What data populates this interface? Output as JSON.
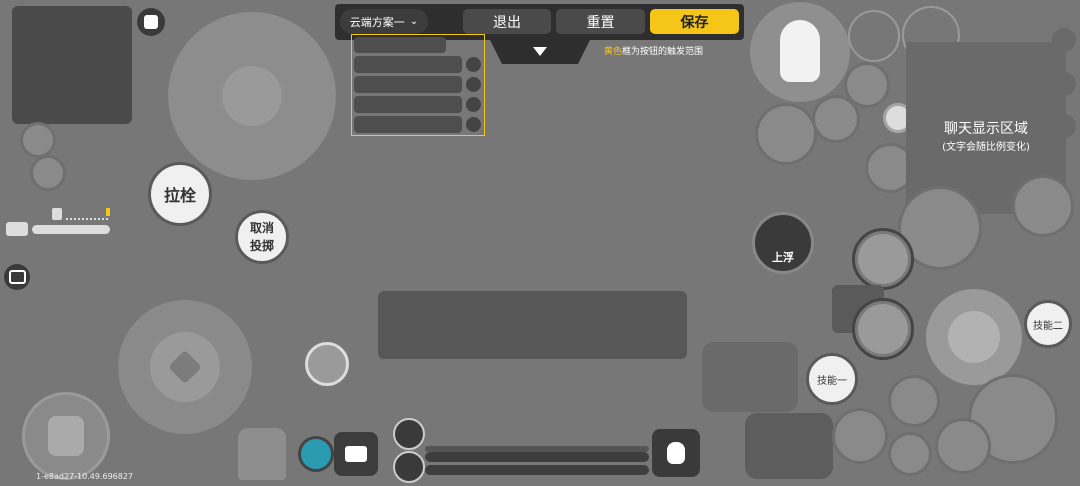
{
  "toolbar": {
    "scheme_label": "云端方案一",
    "exit_label": "退出",
    "reset_label": "重置",
    "save_label": "保存",
    "hint_highlight": "黄色",
    "hint_text": "框为按钮的触发范围"
  },
  "buttons": {
    "pull_bolt": "拉栓",
    "cancel_throw_line1": "取消",
    "cancel_throw_line2": "投掷",
    "float_up": "上浮",
    "skill_one": "技能一",
    "skill_two": "技能二"
  },
  "chat": {
    "title": "聊天显示区域",
    "subtitle": "(文字会随比例变化)"
  },
  "footer": {
    "build_id": "1-e8ad27-10.49.696827"
  },
  "colors": {
    "background": "#777777",
    "accent_yellow": "#f5c518",
    "topbar": "#2e2e2e"
  }
}
